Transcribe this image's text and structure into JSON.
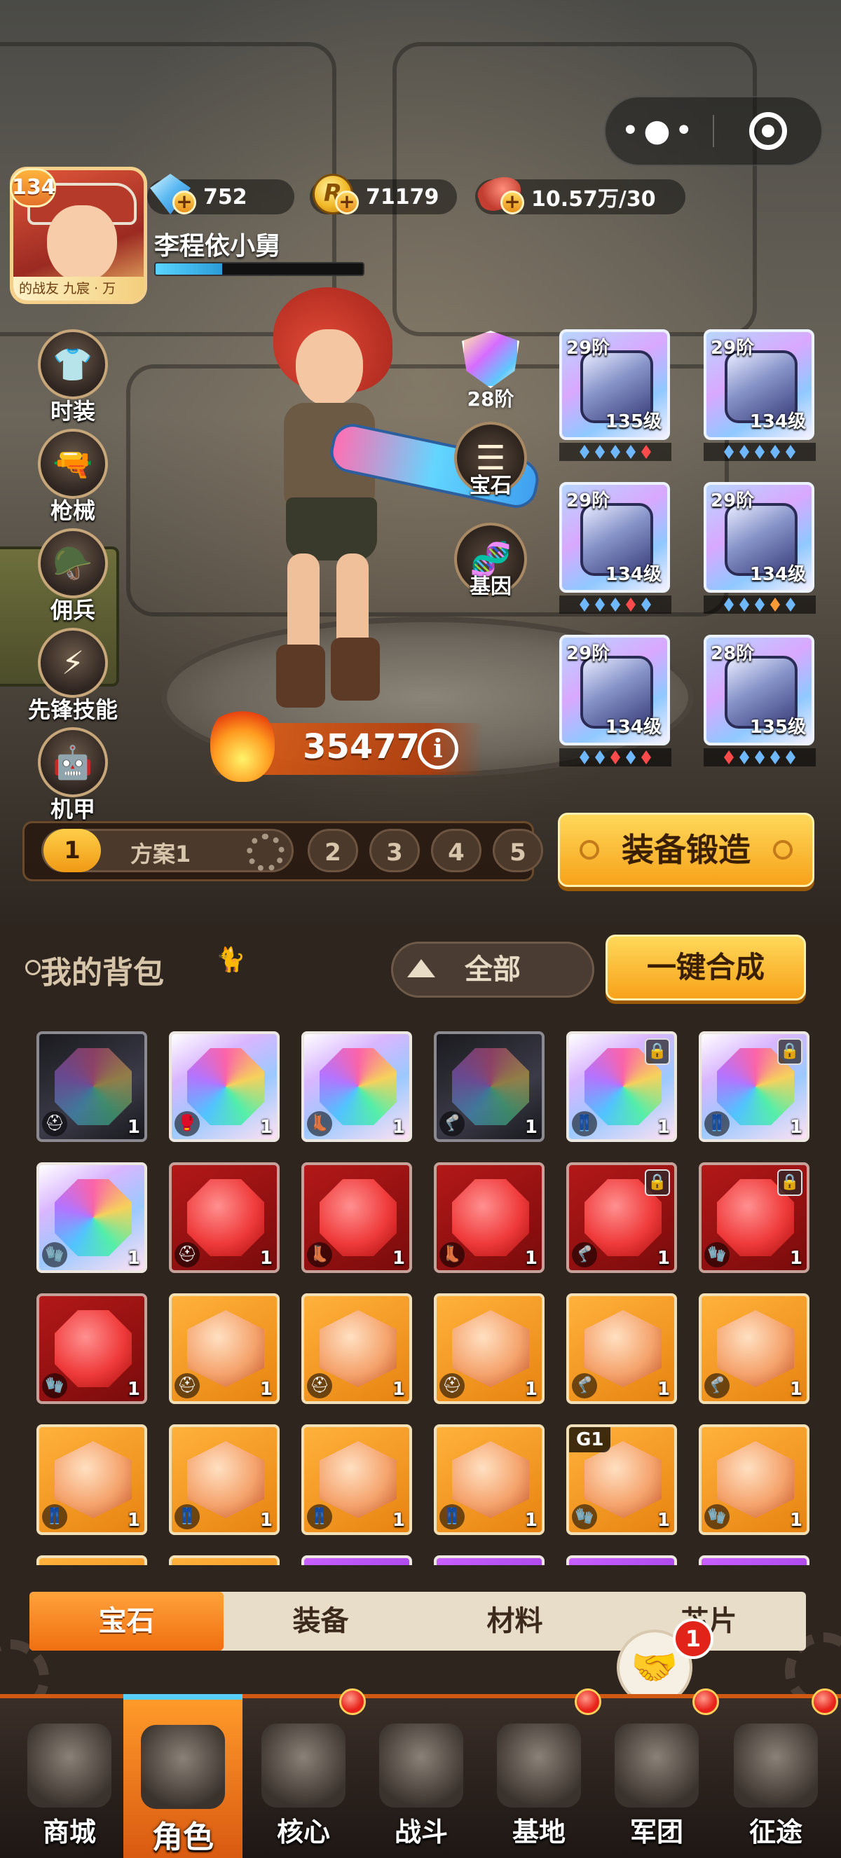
{
  "capsule": {
    "more_icon": "more-dots-icon",
    "close_icon": "target-circle-icon"
  },
  "player": {
    "level": "134",
    "name": "李程依小舅",
    "avatar_tag": "的战友 九宸 · 万",
    "exp_progress": 0.32
  },
  "currencies": [
    {
      "name": "diamond",
      "icon": "diamond-icon",
      "value": "752"
    },
    {
      "name": "gold",
      "icon": "gold-coin-icon",
      "value": "71179",
      "coin_letter": "R"
    },
    {
      "name": "stamina",
      "icon": "meat-icon",
      "value": "10.57万/30"
    }
  ],
  "side_menu": [
    {
      "label": "时装",
      "icon": "outfit-icon",
      "glyph": "👕"
    },
    {
      "label": "枪械",
      "icon": "gun-icon",
      "glyph": "🔫"
    },
    {
      "label": "佣兵",
      "icon": "mercenary-icon",
      "glyph": "🪖"
    },
    {
      "label": "先锋技能",
      "icon": "skill-icon",
      "glyph": "⚡"
    },
    {
      "label": "机甲",
      "icon": "mecha-icon",
      "glyph": "🤖"
    }
  ],
  "rank": {
    "label": "28阶"
  },
  "mid_buttons": {
    "gem": {
      "label": "宝石",
      "glyph": "☰"
    },
    "gene": {
      "label": "基因",
      "glyph": "🧬"
    }
  },
  "power": {
    "value": "35477",
    "info": "i"
  },
  "equipment": [
    {
      "tier": "29阶",
      "level": "135级",
      "gems": [
        "b",
        "b",
        "b",
        "b",
        "r"
      ]
    },
    {
      "tier": "29阶",
      "level": "134级",
      "gems": [
        "b",
        "b",
        "b",
        "b",
        "b"
      ]
    },
    {
      "tier": "29阶",
      "level": "134级",
      "gems": [
        "b",
        "b",
        "b",
        "r",
        "b"
      ]
    },
    {
      "tier": "29阶",
      "level": "134级",
      "gems": [
        "b",
        "b",
        "b",
        "o",
        "b"
      ]
    },
    {
      "tier": "29阶",
      "level": "134级",
      "gems": [
        "b",
        "b",
        "r",
        "b",
        "r"
      ]
    },
    {
      "tier": "28阶",
      "level": "135级",
      "gems": [
        "r",
        "b",
        "b",
        "b",
        "b"
      ]
    }
  ],
  "loadout": {
    "active_num": "1",
    "active_name": "方案1",
    "others": [
      "2",
      "3",
      "4",
      "5"
    ]
  },
  "forge_button": "装备锻造",
  "backpack": {
    "title": "我的背包",
    "filter": "全部",
    "merge": "一键合成",
    "items": [
      {
        "style": "dark",
        "type": "⛑",
        "qty": "1",
        "locked": false
      },
      {
        "style": "rainbow",
        "type": "🥊",
        "qty": "1",
        "locked": false
      },
      {
        "style": "rainbow",
        "type": "👢",
        "qty": "1",
        "locked": false
      },
      {
        "style": "dark",
        "type": "🦿",
        "qty": "1",
        "locked": false
      },
      {
        "style": "rainbow",
        "type": "👖",
        "qty": "1",
        "locked": true
      },
      {
        "style": "rainbow",
        "type": "👖",
        "qty": "1",
        "locked": true
      },
      {
        "style": "rainbow",
        "type": "🧤",
        "qty": "1",
        "locked": false
      },
      {
        "style": "red",
        "type": "⛑",
        "qty": "1",
        "locked": false
      },
      {
        "style": "red",
        "type": "👢",
        "qty": "1",
        "locked": false
      },
      {
        "style": "red",
        "type": "👢",
        "qty": "1",
        "locked": false
      },
      {
        "style": "red",
        "type": "🦿",
        "qty": "1",
        "locked": true
      },
      {
        "style": "red",
        "type": "🧤",
        "qty": "1",
        "locked": true
      },
      {
        "style": "red",
        "type": "🧤",
        "qty": "1",
        "locked": false
      },
      {
        "style": "orange",
        "type": "⛑",
        "qty": "1",
        "locked": false
      },
      {
        "style": "orange",
        "type": "⛑",
        "qty": "1",
        "locked": false
      },
      {
        "style": "orange",
        "type": "⛑",
        "qty": "1",
        "locked": false
      },
      {
        "style": "orange",
        "type": "🦿",
        "qty": "1",
        "locked": false
      },
      {
        "style": "orange",
        "type": "🦿",
        "qty": "1",
        "locked": false
      },
      {
        "style": "orange",
        "type": "👖",
        "qty": "1",
        "locked": false
      },
      {
        "style": "orange",
        "type": "👖",
        "qty": "1",
        "locked": false
      },
      {
        "style": "orange",
        "type": "👖",
        "qty": "1",
        "locked": false
      },
      {
        "style": "orange",
        "type": "👖",
        "qty": "1",
        "locked": false
      },
      {
        "style": "orange",
        "type": "🧤",
        "qty": "1",
        "locked": false,
        "tag": "G1"
      },
      {
        "style": "orange",
        "type": "🧤",
        "qty": "1",
        "locked": false
      },
      {
        "style": "orange",
        "type": "",
        "qty": "",
        "locked": false
      },
      {
        "style": "orange",
        "type": "",
        "qty": "",
        "locked": false
      },
      {
        "style": "purple",
        "type": "",
        "qty": "",
        "locked": false
      },
      {
        "style": "purple",
        "type": "",
        "qty": "",
        "locked": false
      },
      {
        "style": "purple",
        "type": "",
        "qty": "",
        "locked": false
      },
      {
        "style": "purple",
        "type": "",
        "qty": "",
        "locked": false
      }
    ]
  },
  "category_tabs": [
    {
      "label": "宝石",
      "active": true
    },
    {
      "label": "装备",
      "active": false
    },
    {
      "label": "材料",
      "active": false
    },
    {
      "label": "芯片",
      "active": false
    }
  ],
  "alliance": {
    "badge": "1",
    "icon": "handshake-icon"
  },
  "bottom_nav": [
    {
      "label": "商城",
      "icon": "shop-icon",
      "active": false,
      "dot": false
    },
    {
      "label": "角色",
      "icon": "character-icon",
      "active": true,
      "dot": false
    },
    {
      "label": "核心",
      "icon": "core-icon",
      "active": false,
      "dot": true
    },
    {
      "label": "战斗",
      "icon": "battle-icon",
      "active": false,
      "dot": false
    },
    {
      "label": "基地",
      "icon": "base-icon",
      "active": false,
      "dot": true
    },
    {
      "label": "军团",
      "icon": "legion-icon",
      "active": false,
      "dot": true
    },
    {
      "label": "征途",
      "icon": "journey-icon",
      "active": false,
      "dot": true
    }
  ]
}
